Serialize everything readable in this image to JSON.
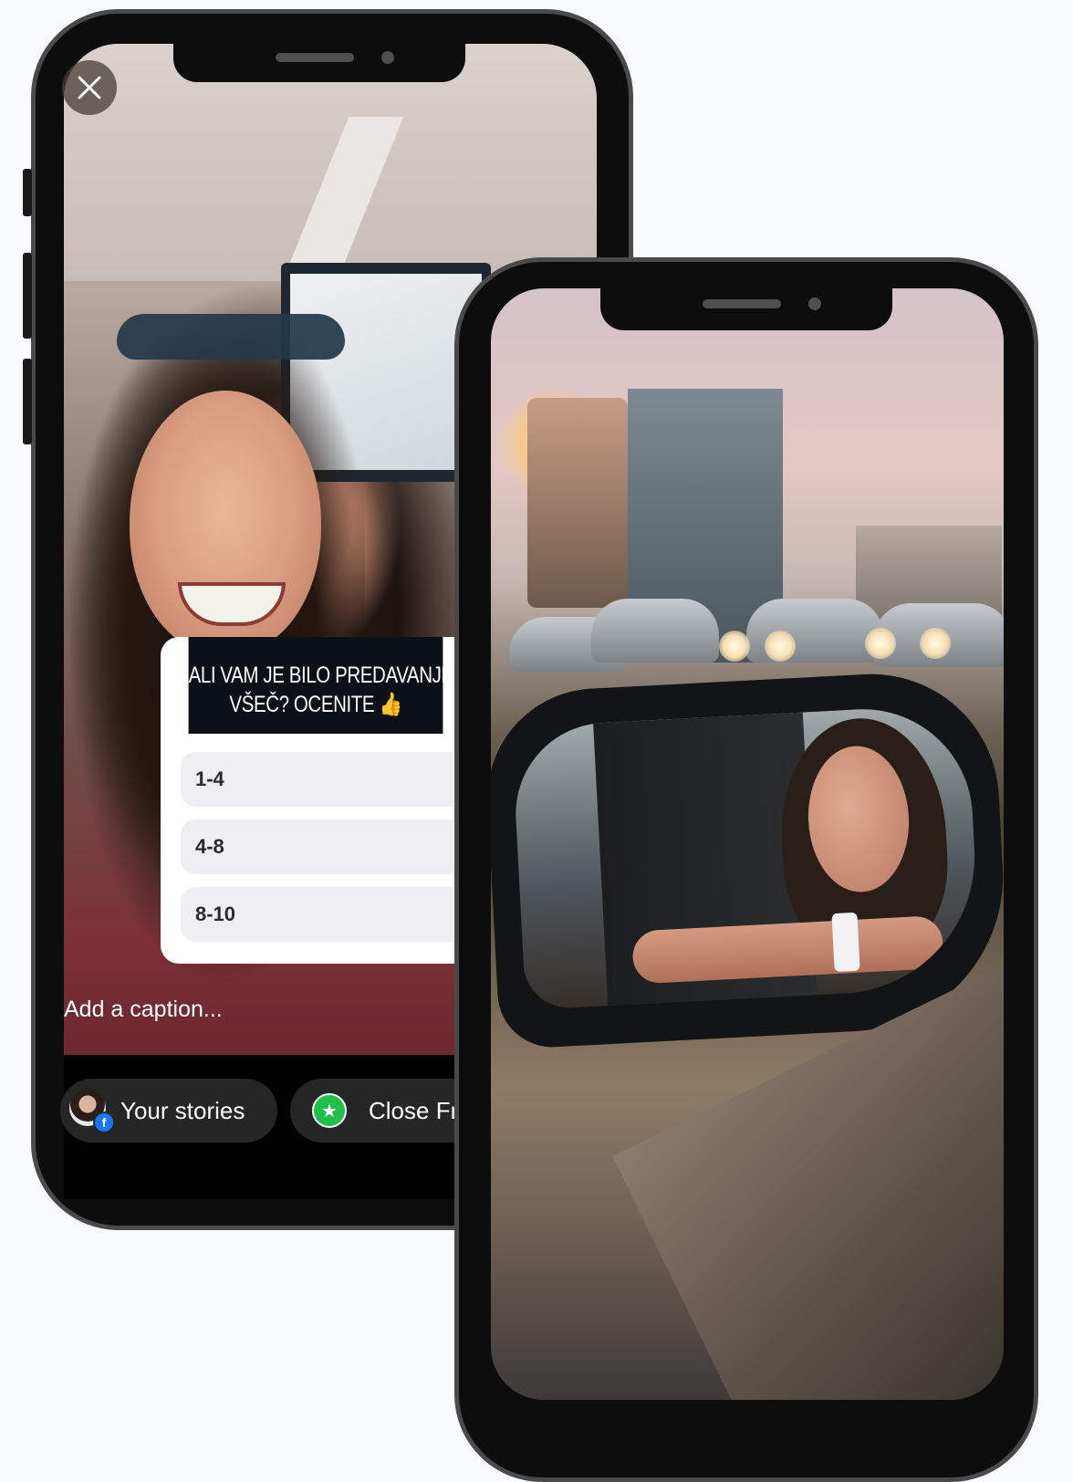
{
  "story_editor": {
    "poll": {
      "question_line1": "ALI VAM JE BILO PREDAVANJE",
      "question_line2": "VŠEČ? OCENITE",
      "question_emoji": "👍",
      "options": [
        "1-4",
        "4-8",
        "8-10"
      ]
    },
    "caption_placeholder": "Add a caption...",
    "share_targets": [
      {
        "label": "Your stories",
        "icon": "profile-avatar-facebook-icon"
      },
      {
        "label": "Close Fr",
        "icon": "green-star-icon"
      }
    ],
    "close_icon": "close-icon"
  },
  "colors": {
    "poll_header_bg": "#0c1017",
    "option_bg": "#efeff3",
    "close_friends_green": "#1fbf49",
    "facebook_blue": "#1877f2"
  }
}
